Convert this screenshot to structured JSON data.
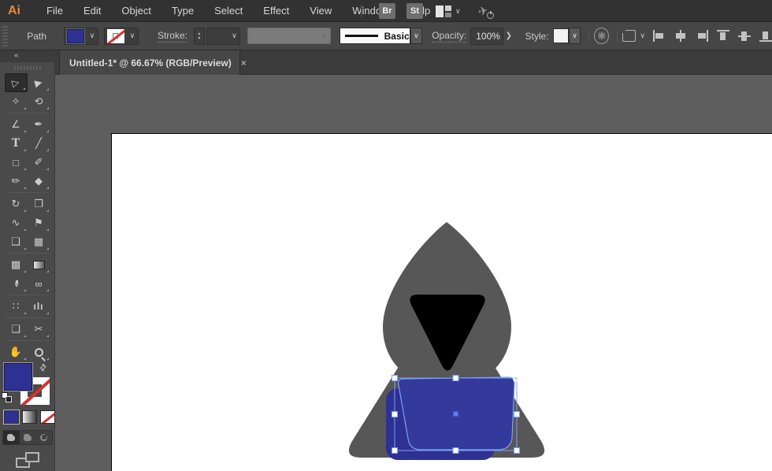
{
  "menubar": {
    "logo": "Ai",
    "items": [
      "File",
      "Edit",
      "Object",
      "Type",
      "Select",
      "Effect",
      "View",
      "Window",
      "Help"
    ],
    "bridge_button": "Br",
    "stock_button": "St"
  },
  "controlbar": {
    "selection_type": "Path",
    "stroke_label": "Stroke:",
    "brush_value": "Basic",
    "opacity_label": "Opacity:",
    "opacity_value": "100%",
    "style_label": "Style:"
  },
  "tab": {
    "title": "Untitled-1* @ 66.67% (RGB/Preview)",
    "zoom_level": "66.67%",
    "close_glyph": "×"
  },
  "ui_glyphs": {
    "chevron_down": "∨",
    "chevron_right": "❯",
    "collapse": "«",
    "step_up": "▴",
    "step_down": "▾",
    "swap": "⇄",
    "wheel": "❋",
    "rocket": "✈"
  },
  "toolbar": {
    "tools": [
      {
        "name": "selection-tool",
        "glyph": "▷",
        "active": true
      },
      {
        "name": "direct-selection-tool",
        "glyph": "▶"
      },
      {
        "name": "magic-wand-tool",
        "glyph": "✧"
      },
      {
        "name": "lasso-tool",
        "glyph": "⟲"
      },
      {
        "name": "curvature-tool",
        "glyph": "∠"
      },
      {
        "name": "pen-tool",
        "glyph": "✒"
      },
      {
        "name": "type-tool",
        "glyph": "T"
      },
      {
        "name": "line-segment-tool",
        "glyph": "╱"
      },
      {
        "name": "rectangle-tool",
        "glyph": "□"
      },
      {
        "name": "paintbrush-tool",
        "glyph": "✐"
      },
      {
        "name": "shaper-tool",
        "glyph": "✏"
      },
      {
        "name": "eraser-tool",
        "glyph": "◆"
      },
      {
        "name": "rotate-tool",
        "glyph": "↻"
      },
      {
        "name": "scale-tool",
        "glyph": "❐"
      },
      {
        "name": "width-tool",
        "glyph": "∿"
      },
      {
        "name": "puppet-warp-tool",
        "glyph": "⚑"
      },
      {
        "name": "shape-builder-tool",
        "glyph": "❑"
      },
      {
        "name": "perspective-grid-tool",
        "glyph": "▦"
      },
      {
        "name": "mesh-tool",
        "glyph": "▩"
      },
      {
        "name": "gradient-tool",
        "glyph": ""
      },
      {
        "name": "eyedropper-tool",
        "glyph": "✒"
      },
      {
        "name": "blend-tool",
        "glyph": "∞"
      },
      {
        "name": "symbol-sprayer-tool",
        "glyph": "∷"
      },
      {
        "name": "column-graph-tool",
        "glyph": "ılı"
      },
      {
        "name": "artboard-tool",
        "glyph": "❏"
      },
      {
        "name": "slice-tool",
        "glyph": "✂"
      },
      {
        "name": "hand-tool",
        "glyph": "✋"
      },
      {
        "name": "zoom-tool",
        "glyph": ""
      }
    ],
    "align_icons": [
      "align-horizontal-left",
      "align-horizontal-center",
      "align-horizontal-right",
      "align-vertical-top",
      "align-vertical-center",
      "align-vertical-bottom"
    ],
    "draw_modes": [
      "draw-normal",
      "draw-behind",
      "draw-inside"
    ]
  },
  "colors": {
    "logo_orange": "#E8883B",
    "fill_blue": "#2E3192",
    "laptop_front_blue": "#333A9C",
    "laptop_back_blue": "#2E3192",
    "artwork_gray": "#575757",
    "face_black": "#000000",
    "selection_blue": "#7CA0F5",
    "handle_fill": "#FFFFFF",
    "center_point_blue": "#5D7CE8",
    "none_red": "#E02D2D"
  }
}
